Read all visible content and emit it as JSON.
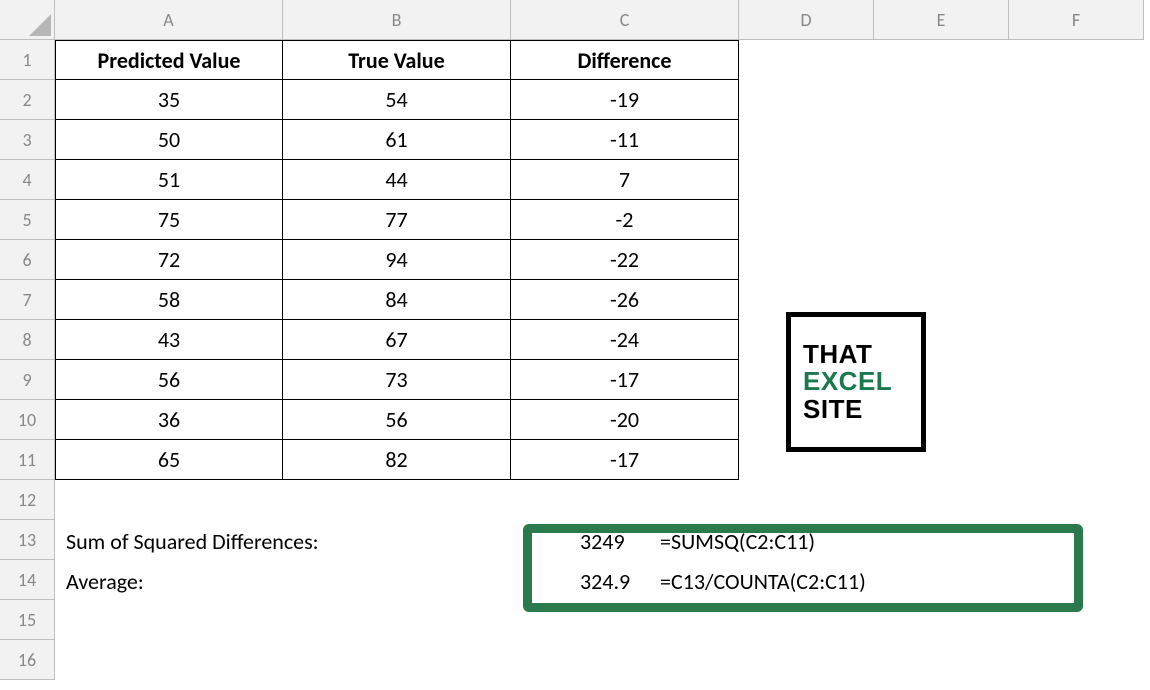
{
  "columns": [
    "A",
    "B",
    "C",
    "D",
    "E",
    "F"
  ],
  "rows": [
    "1",
    "2",
    "3",
    "4",
    "5",
    "6",
    "7",
    "8",
    "9",
    "10",
    "11",
    "12",
    "13",
    "14",
    "15",
    "16"
  ],
  "headers": {
    "A": "Predicted Value",
    "B": "True Value",
    "C": "Difference"
  },
  "data": [
    {
      "pred": "35",
      "true": "54",
      "diff": "-19"
    },
    {
      "pred": "50",
      "true": "61",
      "diff": "-11"
    },
    {
      "pred": "51",
      "true": "44",
      "diff": "7"
    },
    {
      "pred": "75",
      "true": "77",
      "diff": "-2"
    },
    {
      "pred": "72",
      "true": "94",
      "diff": "-22"
    },
    {
      "pred": "58",
      "true": "84",
      "diff": "-26"
    },
    {
      "pred": "43",
      "true": "67",
      "diff": "-24"
    },
    {
      "pred": "56",
      "true": "73",
      "diff": "-17"
    },
    {
      "pred": "36",
      "true": "56",
      "diff": "-20"
    },
    {
      "pred": "65",
      "true": "82",
      "diff": "-17"
    }
  ],
  "summary": {
    "row13_label": "Sum of Squared Differences:",
    "row13_value": "3249",
    "row13_formula": "=SUMSQ(C2:C11)",
    "row14_label": "Average:",
    "row14_value": "324.9",
    "row14_formula": "=C13/COUNTA(C2:C11)"
  },
  "logo": {
    "line1": "THAT",
    "line2": "EXCEL",
    "line3": "SITE"
  }
}
